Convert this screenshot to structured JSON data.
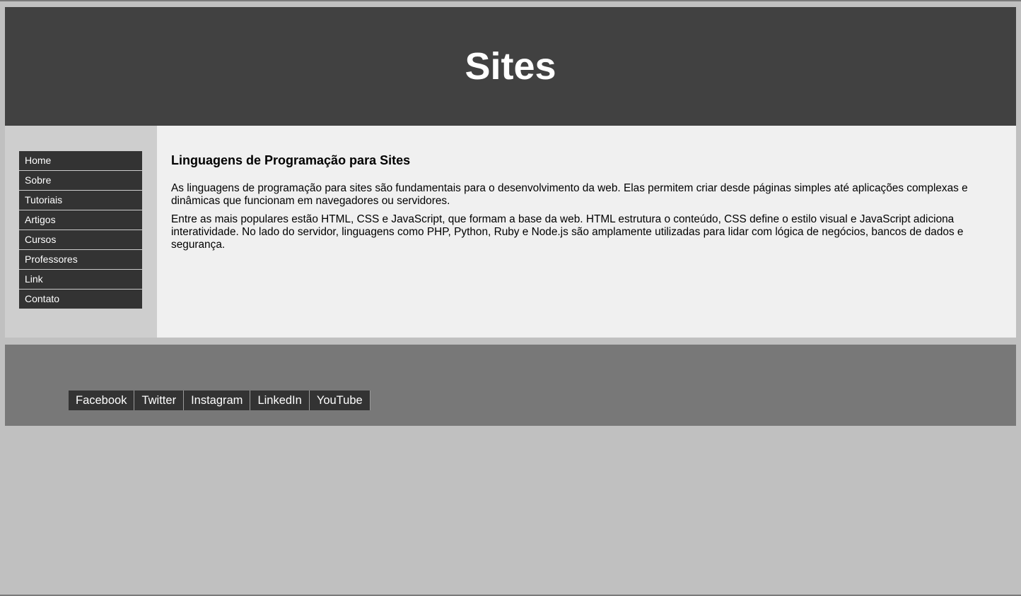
{
  "header": {
    "title": "Sites"
  },
  "sidebar": {
    "items": [
      {
        "label": "Home"
      },
      {
        "label": "Sobre"
      },
      {
        "label": "Tutoriais"
      },
      {
        "label": "Artigos"
      },
      {
        "label": "Cursos"
      },
      {
        "label": "Professores"
      },
      {
        "label": "Link"
      },
      {
        "label": "Contato"
      }
    ]
  },
  "main": {
    "heading": "Linguagens de Programação para Sites",
    "paragraphs": [
      "As linguagens de programação para sites são fundamentais para o desenvolvimento da web. Elas permitem criar desde páginas simples até aplicações complexas e dinâmicas que funcionam em navegadores ou servidores.",
      "Entre as mais populares estão HTML, CSS e JavaScript, que formam a base da web. HTML estrutura o conteúdo, CSS define o estilo visual e JavaScript adiciona interatividade. No lado do servidor, linguagens como PHP, Python, Ruby e Node.js são amplamente utilizadas para lidar com lógica de negócios, bancos de dados e segurança."
    ]
  },
  "footer": {
    "social": [
      {
        "label": "Facebook"
      },
      {
        "label": "Twitter"
      },
      {
        "label": "Instagram"
      },
      {
        "label": "LinkedIn"
      },
      {
        "label": "YouTube"
      }
    ]
  },
  "colors": {
    "page_background": "#c0c0c0",
    "header_background": "#414141",
    "sidebar_background": "#cecece",
    "nav_item_background": "#333333",
    "main_background": "#f0f0f0",
    "footer_background": "#787878"
  }
}
